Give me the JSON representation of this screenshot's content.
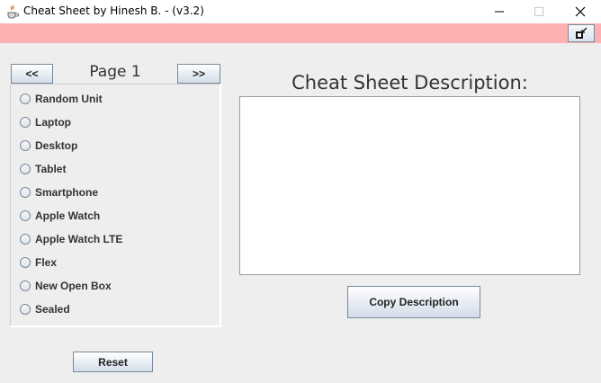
{
  "window": {
    "title": "Cheat Sheet by Hinesh B. - (v3.2)",
    "icon": "java-cup-icon",
    "controls": [
      "minimize-icon",
      "maximize-icon",
      "close-icon"
    ]
  },
  "toolbar": {
    "restore_icon": "restore-window-icon",
    "accent_color": "#ffb0b0"
  },
  "pager": {
    "prev_label": "<<",
    "page_label": "Page 1",
    "next_label": ">>"
  },
  "options": [
    {
      "label": "Random Unit",
      "selected": false
    },
    {
      "label": "Laptop",
      "selected": false
    },
    {
      "label": "Desktop",
      "selected": false
    },
    {
      "label": "Tablet",
      "selected": false
    },
    {
      "label": "Smartphone",
      "selected": false
    },
    {
      "label": "Apple Watch",
      "selected": false
    },
    {
      "label": "Apple Watch LTE",
      "selected": false
    },
    {
      "label": "Flex",
      "selected": false
    },
    {
      "label": "New Open Box",
      "selected": false
    },
    {
      "label": "Sealed",
      "selected": false
    }
  ],
  "description": {
    "heading": "Cheat Sheet Description:",
    "text": "",
    "copy_label": "Copy Description"
  },
  "reset_label": "Reset"
}
